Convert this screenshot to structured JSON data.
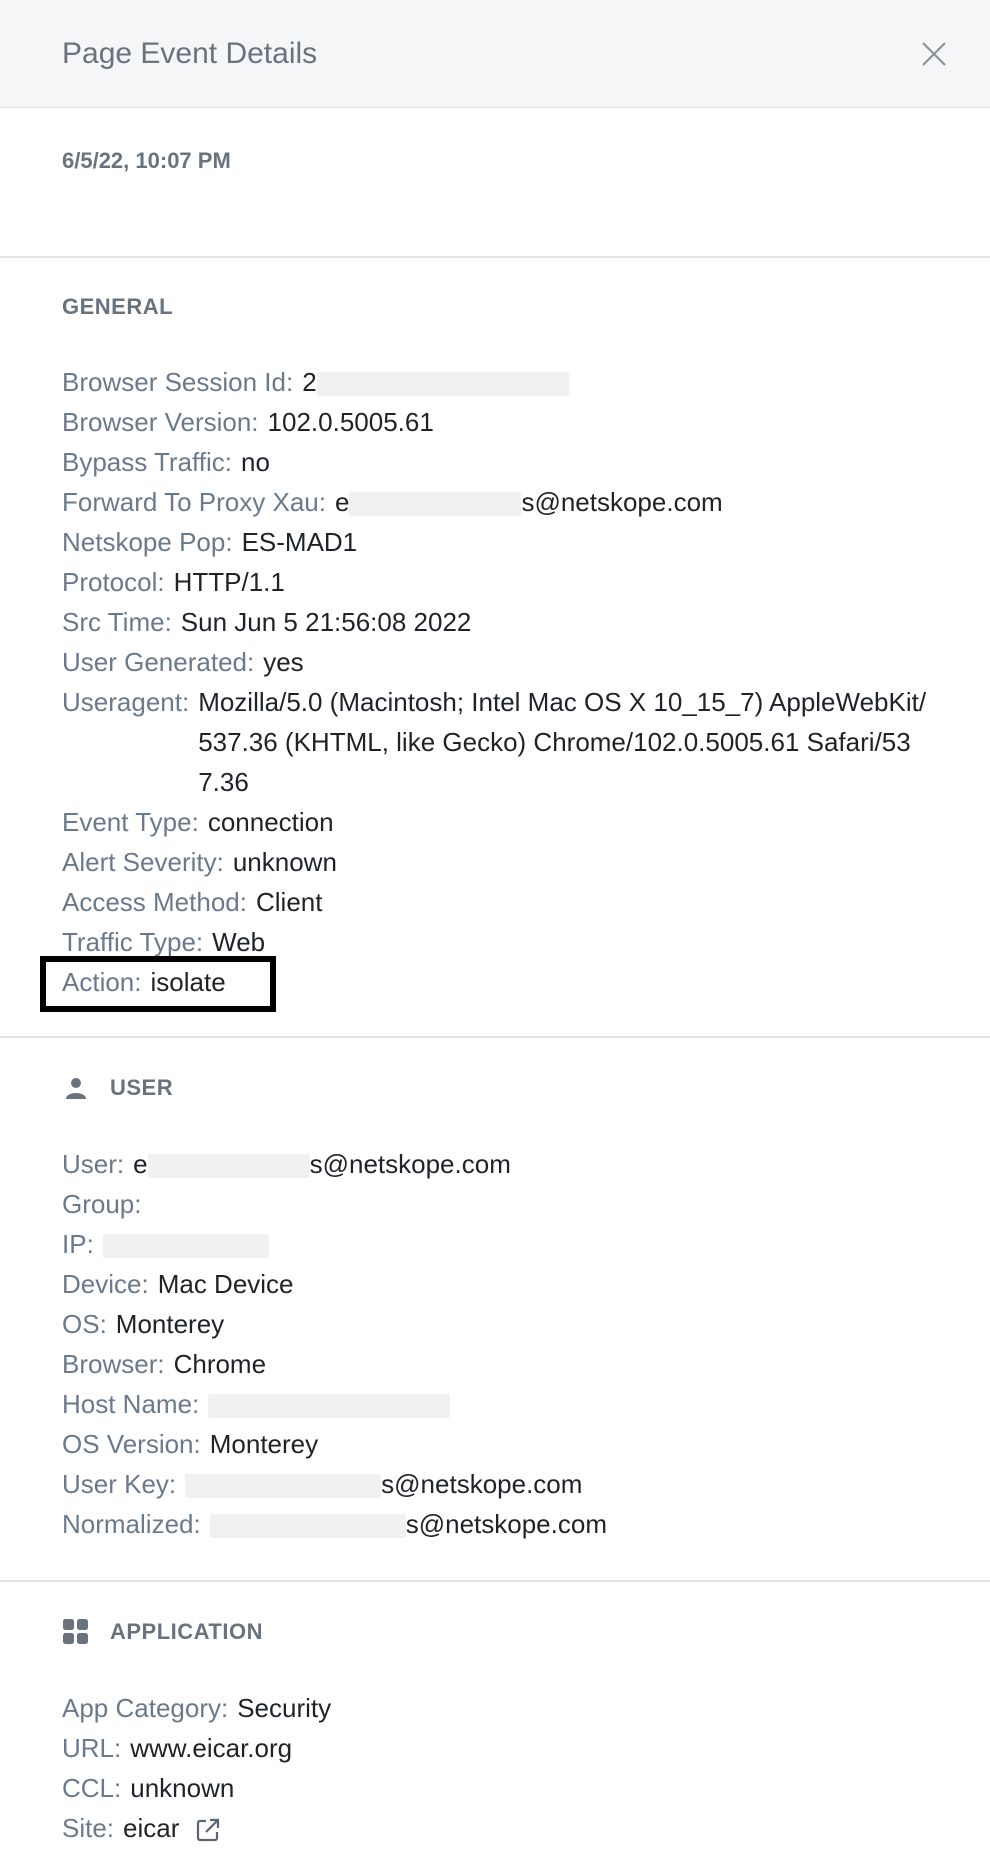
{
  "header": {
    "title": "Page Event Details",
    "close_icon": "close-icon"
  },
  "timestamp": "6/5/22, 10:07 PM",
  "general": {
    "title": "GENERAL",
    "rows": {
      "browser_session_id": {
        "label": "Browser Session Id:",
        "value": "2"
      },
      "browser_version": {
        "label": "Browser Version:",
        "value": "102.0.5005.61"
      },
      "bypass_traffic": {
        "label": "Bypass Traffic:",
        "value": "no"
      },
      "forward_to_proxy_xau": {
        "label": "Forward To Proxy Xau:",
        "value_prefix": "e",
        "value_suffix": "s@netskope.com"
      },
      "netskope_pop": {
        "label": "Netskope Pop:",
        "value": "ES-MAD1"
      },
      "protocol": {
        "label": "Protocol:",
        "value": "HTTP/1.1"
      },
      "src_time": {
        "label": "Src Time:",
        "value": "Sun Jun 5 21:56:08 2022"
      },
      "user_generated": {
        "label": "User Generated:",
        "value": "yes"
      },
      "useragent": {
        "label": "Useragent:",
        "value": "Mozilla/5.0 (Macintosh; Intel Mac OS X 10_15_7) AppleWebKit/537.36 (KHTML, like Gecko) Chrome/102.0.5005.61 Safari/537.36"
      },
      "event_type": {
        "label": "Event Type:",
        "value": "connection"
      },
      "alert_severity": {
        "label": "Alert Severity:",
        "value": "unknown"
      },
      "access_method": {
        "label": "Access Method:",
        "value": "Client"
      },
      "traffic_type": {
        "label": "Traffic Type:",
        "value": "Web"
      },
      "action": {
        "label": "Action:",
        "value": "isolate"
      }
    }
  },
  "user": {
    "title": "USER",
    "icon": "person-icon",
    "rows": {
      "user": {
        "label": "User:",
        "value_prefix": "e",
        "value_suffix": "s@netskope.com"
      },
      "group": {
        "label": "Group:",
        "value": ""
      },
      "ip": {
        "label": "IP:",
        "value": ""
      },
      "device": {
        "label": "Device:",
        "value": "Mac Device"
      },
      "os": {
        "label": "OS:",
        "value": "Monterey"
      },
      "browser": {
        "label": "Browser:",
        "value": "Chrome"
      },
      "host_name": {
        "label": "Host Name:",
        "value": ""
      },
      "os_version": {
        "label": "OS Version:",
        "value": "Monterey"
      },
      "user_key": {
        "label": "User Key:",
        "value_suffix": "s@netskope.com"
      },
      "normalized": {
        "label": "Normalized:",
        "value_suffix": "s@netskope.com"
      }
    }
  },
  "application": {
    "title": "APPLICATION",
    "icon": "grid-icon",
    "rows": {
      "app_category": {
        "label": "App Category:",
        "value": "Security"
      },
      "url": {
        "label": "URL:",
        "value": "www.eicar.org"
      },
      "ccl": {
        "label": "CCL:",
        "value": "unknown"
      },
      "site": {
        "label": "Site:",
        "value": "eicar",
        "icon": "external-link-icon"
      }
    }
  }
}
